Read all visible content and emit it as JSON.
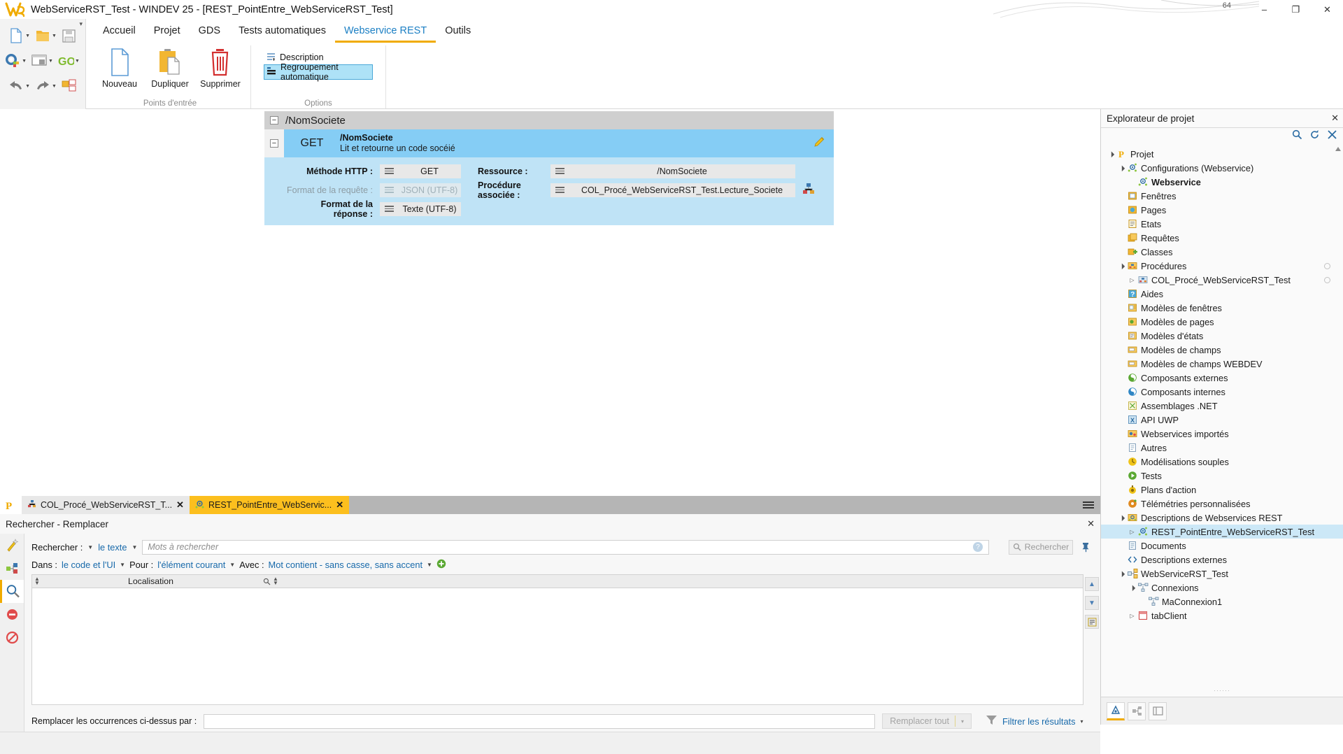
{
  "window": {
    "title": "WebServiceRST_Test - WINDEV 25 - [REST_PointEntre_WebServiceRST_Test]",
    "logo_text": "25",
    "minimize": "–",
    "maximize": "❐",
    "close": "✕",
    "search_icon": "search-icon",
    "badge_number": "64"
  },
  "ribbon": {
    "tabs": [
      {
        "label": "Accueil",
        "active": false
      },
      {
        "label": "Projet",
        "active": false
      },
      {
        "label": "GDS",
        "active": false
      },
      {
        "label": "Tests automatiques",
        "active": false
      },
      {
        "label": "Webservice REST",
        "active": true
      },
      {
        "label": "Outils",
        "active": false
      }
    ],
    "groups": [
      {
        "title": "Points d'entrée",
        "buttons": [
          {
            "label": "Nouveau",
            "icon": "new-document-icon"
          },
          {
            "label": "Dupliquer",
            "icon": "duplicate-icon"
          },
          {
            "label": "Supprimer",
            "icon": "trash-icon"
          }
        ]
      },
      {
        "title": "Options",
        "items": [
          {
            "label": "Description",
            "icon": "description-icon",
            "selected": false
          },
          {
            "label": "Regroupement automatique",
            "icon": "grouping-icon",
            "selected": true
          }
        ]
      }
    ]
  },
  "editor": {
    "group_name": "/NomSociete",
    "route": {
      "verb": "GET",
      "path": "/NomSociete",
      "description": "Lit et retourne un code socéié",
      "edit_icon": "pencil-icon"
    },
    "fields": {
      "method_label": "Méthode HTTP :",
      "method_value": "GET",
      "resource_label": "Ressource :",
      "resource_value": "/NomSociete",
      "request_format_label": "Format de la requête :",
      "request_format_value": "JSON (UTF-8)",
      "procedure_label": "Procédure associée :",
      "procedure_value": "COL_Procé_WebServiceRST_Test.Lecture_Societe",
      "procedure_action_icon": "procedure-link-icon",
      "response_format_label": "Format de la réponse :",
      "response_format_value": "Texte (UTF-8)"
    }
  },
  "explorer": {
    "title": "Explorateur de projet",
    "close_icon": "close-icon",
    "header_icons": [
      "search-icon",
      "refresh-icon",
      "collapse-all-icon"
    ],
    "grip": "······",
    "tree": [
      {
        "label": "Projet",
        "depth": 0,
        "twisty": "expanded",
        "icon": "project-icon",
        "selected": false,
        "bold": false,
        "dot": false
      },
      {
        "label": "Configurations (Webservice)",
        "depth": 1,
        "twisty": "expanded",
        "icon": "config-icon",
        "selected": false,
        "bold": false,
        "dot": false
      },
      {
        "label": "Webservice",
        "depth": 2,
        "twisty": "none",
        "icon": "config-icon",
        "selected": false,
        "bold": true,
        "dot": false
      },
      {
        "label": "Fenêtres",
        "depth": 1,
        "twisty": "none",
        "icon": "window-icon",
        "selected": false,
        "bold": false,
        "dot": false
      },
      {
        "label": "Pages",
        "depth": 1,
        "twisty": "none",
        "icon": "page-icon",
        "selected": false,
        "bold": false,
        "dot": false
      },
      {
        "label": "Etats",
        "depth": 1,
        "twisty": "none",
        "icon": "report-icon",
        "selected": false,
        "bold": false,
        "dot": false
      },
      {
        "label": "Requêtes",
        "depth": 1,
        "twisty": "none",
        "icon": "query-icon",
        "selected": false,
        "bold": false,
        "dot": false
      },
      {
        "label": "Classes",
        "depth": 1,
        "twisty": "none",
        "icon": "class-icon",
        "selected": false,
        "bold": false,
        "dot": false
      },
      {
        "label": "Procédures",
        "depth": 1,
        "twisty": "expanded",
        "icon": "procedures-icon",
        "selected": false,
        "bold": false,
        "dot": true
      },
      {
        "label": "COL_Procé_WebServiceRST_Test",
        "depth": 2,
        "twisty": "collapsed",
        "icon": "procedure-set-icon",
        "selected": false,
        "bold": false,
        "dot": true
      },
      {
        "label": "Aides",
        "depth": 1,
        "twisty": "none",
        "icon": "help-icon",
        "selected": false,
        "bold": false,
        "dot": false
      },
      {
        "label": "Modèles de fenêtres",
        "depth": 1,
        "twisty": "none",
        "icon": "window-template-icon",
        "selected": false,
        "bold": false,
        "dot": false
      },
      {
        "label": "Modèles de pages",
        "depth": 1,
        "twisty": "none",
        "icon": "page-template-icon",
        "selected": false,
        "bold": false,
        "dot": false
      },
      {
        "label": "Modèles d'états",
        "depth": 1,
        "twisty": "none",
        "icon": "report-template-icon",
        "selected": false,
        "bold": false,
        "dot": false
      },
      {
        "label": "Modèles de champs",
        "depth": 1,
        "twisty": "none",
        "icon": "field-template-icon",
        "selected": false,
        "bold": false,
        "dot": false
      },
      {
        "label": "Modèles de champs WEBDEV",
        "depth": 1,
        "twisty": "none",
        "icon": "field-template-icon",
        "selected": false,
        "bold": false,
        "dot": false
      },
      {
        "label": "Composants externes",
        "depth": 1,
        "twisty": "none",
        "icon": "external-component-icon",
        "selected": false,
        "bold": false,
        "dot": false
      },
      {
        "label": "Composants internes",
        "depth": 1,
        "twisty": "none",
        "icon": "internal-component-icon",
        "selected": false,
        "bold": false,
        "dot": false
      },
      {
        "label": "Assemblages .NET",
        "depth": 1,
        "twisty": "none",
        "icon": "dotnet-icon",
        "selected": false,
        "bold": false,
        "dot": false
      },
      {
        "label": "API UWP",
        "depth": 1,
        "twisty": "none",
        "icon": "uwp-icon",
        "selected": false,
        "bold": false,
        "dot": false
      },
      {
        "label": "Webservices importés",
        "depth": 1,
        "twisty": "none",
        "icon": "imported-webservice-icon",
        "selected": false,
        "bold": false,
        "dot": false
      },
      {
        "label": "Autres",
        "depth": 1,
        "twisty": "none",
        "icon": "other-icon",
        "selected": false,
        "bold": false,
        "dot": false
      },
      {
        "label": "Modélisations souples",
        "depth": 1,
        "twisty": "none",
        "icon": "modeling-icon",
        "selected": false,
        "bold": false,
        "dot": false
      },
      {
        "label": "Tests",
        "depth": 1,
        "twisty": "none",
        "icon": "tests-icon",
        "selected": false,
        "bold": false,
        "dot": false
      },
      {
        "label": "Plans d'action",
        "depth": 1,
        "twisty": "none",
        "icon": "action-plan-icon",
        "selected": false,
        "bold": false,
        "dot": false
      },
      {
        "label": "Télémétries personnalisées",
        "depth": 1,
        "twisty": "none",
        "icon": "telemetry-icon",
        "selected": false,
        "bold": false,
        "dot": false
      },
      {
        "label": "Descriptions de Webservices REST",
        "depth": 1,
        "twisty": "expanded",
        "icon": "rest-folder-icon",
        "selected": false,
        "bold": false,
        "dot": false
      },
      {
        "label": "REST_PointEntre_WebServiceRST_Test",
        "depth": 2,
        "twisty": "collapsed",
        "icon": "rest-icon",
        "selected": true,
        "bold": false,
        "dot": false
      },
      {
        "label": "Documents",
        "depth": 1,
        "twisty": "none",
        "icon": "documents-icon",
        "selected": false,
        "bold": false,
        "dot": false
      },
      {
        "label": "Descriptions externes",
        "depth": 1,
        "twisty": "none",
        "icon": "code-brackets-icon",
        "selected": false,
        "bold": false,
        "dot": false
      },
      {
        "label": "WebServiceRST_Test",
        "depth": 1,
        "twisty": "expanded",
        "icon": "analysis-icon",
        "selected": false,
        "bold": false,
        "dot": false
      },
      {
        "label": "Connexions",
        "depth": 2,
        "twisty": "expanded",
        "icon": "connections-icon",
        "selected": false,
        "bold": false,
        "dot": false
      },
      {
        "label": "MaConnexion1",
        "depth": 3,
        "twisty": "none",
        "icon": "connection-icon",
        "selected": false,
        "bold": false,
        "dot": false
      },
      {
        "label": "tabClient",
        "depth": 2,
        "twisty": "collapsed",
        "icon": "table-icon",
        "selected": false,
        "bold": false,
        "dot": false
      }
    ],
    "bottom_tabs": [
      {
        "icon": "explorer-tab-icon",
        "active": true
      },
      {
        "icon": "analysis-tab-icon",
        "active": false
      },
      {
        "icon": "misc-tab-icon",
        "active": false
      }
    ]
  },
  "dock": {
    "tabs": [
      {
        "label": "COL_Procé_WebServiceRST_T...",
        "icon": "procedure-set-icon",
        "active": false,
        "close": "✕"
      },
      {
        "label": "REST_PointEntre_WebServic...",
        "icon": "rest-icon",
        "active": true,
        "close": "✕"
      }
    ],
    "menu_icon": "hamburger-icon"
  },
  "search_panel": {
    "title": "Rechercher - Remplacer",
    "close_icon": "close-icon",
    "pin_icon": "pin-icon",
    "left_tools": [
      {
        "icon": "wand-icon",
        "active": false
      },
      {
        "icon": "refactor-icon",
        "active": false
      },
      {
        "icon": "search-icon",
        "active": true
      },
      {
        "icon": "error-icon",
        "active": false
      },
      {
        "icon": "blocked-icon",
        "active": false
      }
    ],
    "row1": {
      "label": "Rechercher :",
      "scope_value": "le texte",
      "input_placeholder": "Mots à rechercher",
      "input_value": "",
      "help_badge": "?",
      "go_button": "Rechercher",
      "go_icon": "search-icon"
    },
    "row2": {
      "dans_label": "Dans :",
      "dans_value": "le code et l'UI",
      "pour_label": "Pour :",
      "pour_value": "l'élément courant",
      "avec_label": "Avec :",
      "avec_value": "Mot contient - sans casse, sans accent",
      "add_icon": "add-circle-icon"
    },
    "results": {
      "column_header": "Localisation",
      "search_icon": "search-icon",
      "rows": []
    },
    "side_buttons": [
      {
        "icon": "arrow-up-icon"
      },
      {
        "icon": "arrow-down-icon"
      },
      {
        "icon": "list-icon"
      }
    ],
    "footer": {
      "replace_label": "Remplacer les occurrences ci-dessus par :",
      "replace_value": "",
      "replace_all_button": "Remplacer tout",
      "replace_all_caret": "▾",
      "filter_icon": "funnel-icon",
      "filter_label": "Filtrer les résultats",
      "filter_caret": "▾"
    }
  },
  "colors": {
    "accent_blue": "#1b7fc4",
    "accent_yellow": "#f0ab00",
    "route_blue": "#85cdf5",
    "detail_blue": "#bfe3f6",
    "tab_active": "#fcbf1e",
    "tree_selected": "#cce8f7"
  }
}
